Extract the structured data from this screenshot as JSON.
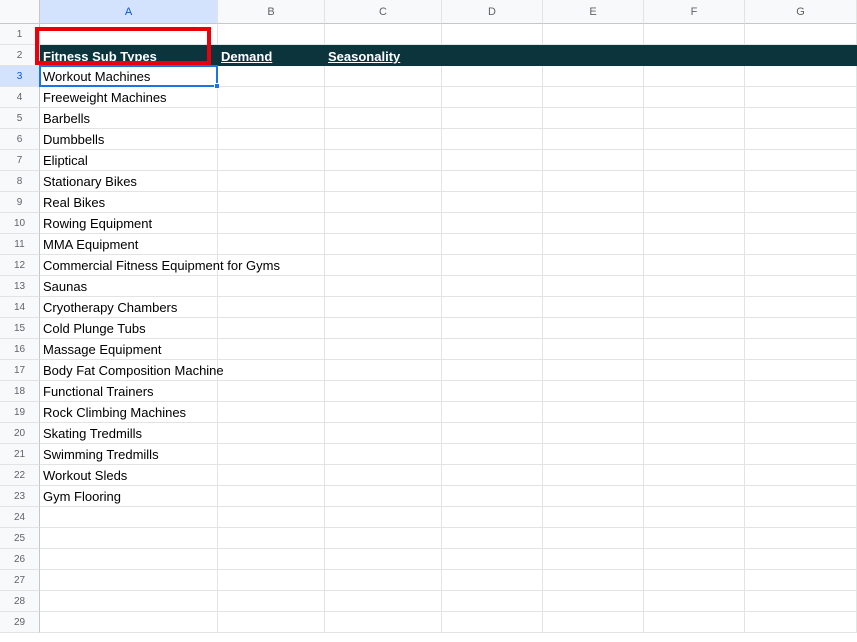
{
  "columns": [
    "A",
    "B",
    "C",
    "D",
    "E",
    "F",
    "G"
  ],
  "rows": [
    "1",
    "2",
    "3",
    "4",
    "5",
    "6",
    "7",
    "8",
    "9",
    "10",
    "11",
    "12",
    "13",
    "14",
    "15",
    "16",
    "17",
    "18",
    "19",
    "20",
    "21",
    "22",
    "23",
    "24",
    "25",
    "26",
    "27",
    "28",
    "29"
  ],
  "headers": {
    "a2": "Fitness Sub Types",
    "b2": "Demand",
    "c2": "Seasonality"
  },
  "header_color": "#0c343d",
  "selection_color": "#1a73e8",
  "highlight_color": "#e8000b",
  "selected_cell": "A3",
  "items": [
    "Workout Machines",
    "Freeweight Machines",
    "Barbells",
    "Dumbbells",
    "Eliptical",
    "Stationary Bikes",
    "Real Bikes",
    "Rowing Equipment",
    "MMA Equipment",
    "Commercial Fitness Equipment for Gyms",
    "Saunas",
    "Cryotherapy Chambers",
    "Cold Plunge Tubs",
    "Massage Equipment",
    "Body Fat Composition Machine",
    "Functional Trainers",
    "Rock Climbing Machines",
    "Skating Tredmills",
    "Swimming Tredmills",
    "Workout Sleds",
    "Gym Flooring"
  ]
}
